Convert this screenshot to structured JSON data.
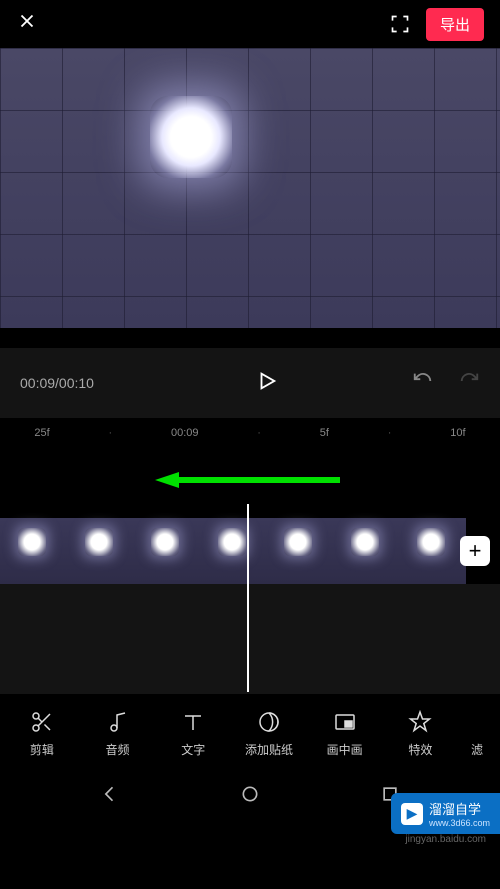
{
  "topBar": {
    "exportLabel": "导出"
  },
  "playback": {
    "timeDisplay": "00:09/00:10"
  },
  "ruler": {
    "marks": [
      "25f",
      "·",
      "00:09",
      "·",
      "5f",
      "·",
      "10f"
    ]
  },
  "tools": [
    {
      "name": "edit",
      "label": "剪辑",
      "icon": "scissors"
    },
    {
      "name": "audio",
      "label": "音频",
      "icon": "music-note"
    },
    {
      "name": "text",
      "label": "文字",
      "icon": "text-t"
    },
    {
      "name": "sticker",
      "label": "添加贴纸",
      "icon": "sticker"
    },
    {
      "name": "pip",
      "label": "画中画",
      "icon": "pip"
    },
    {
      "name": "effects",
      "label": "特效",
      "icon": "star"
    },
    {
      "name": "filter",
      "label": "滤",
      "icon": ""
    }
  ],
  "watermark": {
    "title": "溜溜自学",
    "sub": "www.3d66.com"
  },
  "footer": {
    "text": "jingyan.baidu.com"
  },
  "addButton": "+"
}
